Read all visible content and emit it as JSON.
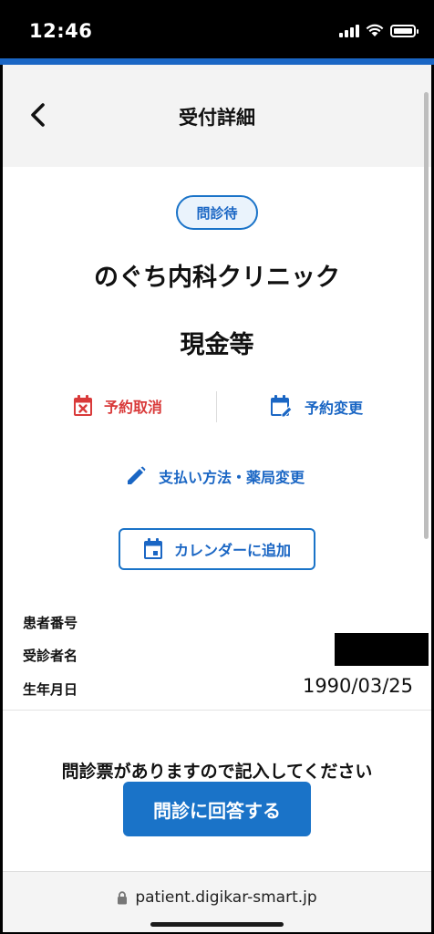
{
  "status_bar": {
    "time": "12:46",
    "icons": [
      "signal-icon",
      "wifi-icon",
      "battery-icon"
    ]
  },
  "header": {
    "title": "受付詳細",
    "back_icon": "chevron-left-icon"
  },
  "status_badge": "問診待",
  "clinic_name": "のぐち内科クリニック",
  "payment_method": "現金等",
  "actions": {
    "cancel_label": "予約取消",
    "change_label": "予約変更",
    "payment_pharmacy_change_label": "支払い方法・薬局変更",
    "add_calendar_label": "カレンダーに追加"
  },
  "patient_info": {
    "patient_number_label": "患者番号",
    "patient_name_label": "受診者名",
    "birth_date_label": "生年月日",
    "birth_date_value": "1990/03/25"
  },
  "questionnaire": {
    "notice": "問診票がありますので記入してください",
    "button_label": "問診に回答する"
  },
  "url_bar": {
    "url": "patient.digikar-smart.jp"
  },
  "colors": {
    "primary": "#1a73c8",
    "danger": "#d93a3a",
    "accent_line": "#1a66c4",
    "header_bg": "#f3f3f3"
  }
}
